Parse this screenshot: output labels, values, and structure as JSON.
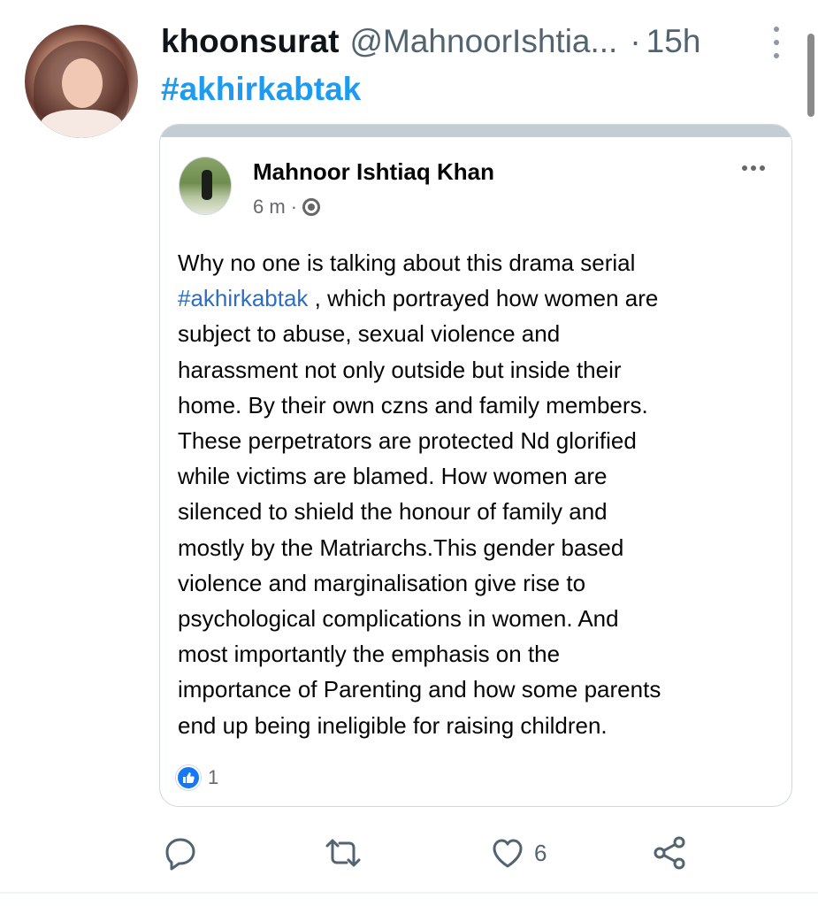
{
  "tweet": {
    "display_name": "khoonsurat",
    "handle": "@MahnoorIshtia...",
    "separator": "·",
    "time": "15h",
    "hashtag": "#akhirkabtak"
  },
  "embedded_post": {
    "author": "Mahnoor Ishtiaq Khan",
    "age": "6 m",
    "separator": "·",
    "privacy_icon": "globe-icon",
    "hashtag": "#akhirkabtak",
    "body_lines": {
      "l1": "Why no one is talking about this drama serial",
      "l2_rest": " , which portrayed how women are",
      "l3": "subject to abuse, sexual violence and",
      "l4": "harassment not only outside but inside their",
      "l5": "home. By their own czns and family members.",
      "l6": "These perpetrators are protected Nd glorified",
      "l7": "while victims are blamed. How women are",
      "l8": "silenced to shield the honour of family and",
      "l9": "mostly by the Matriarchs.This gender based",
      "l10": "violence and marginalisation give rise to",
      "l11": "psychological complications in women. And",
      "l12": "most importantly the emphasis on the",
      "l13": "importance of Parenting and how some parents",
      "l14": "end up being ineligible for raising children."
    },
    "reaction_icon": "like-icon",
    "reaction_count": "1"
  },
  "actions": {
    "reply_icon": "reply-icon",
    "retweet_icon": "retweet-icon",
    "like_icon": "heart-icon",
    "like_count": "6",
    "share_icon": "share-icon"
  },
  "colors": {
    "link_blue": "#1d9bf0",
    "fb_link_blue": "#2d6ec4",
    "secondary_text": "#536471",
    "facebook_blue": "#1877f2"
  }
}
